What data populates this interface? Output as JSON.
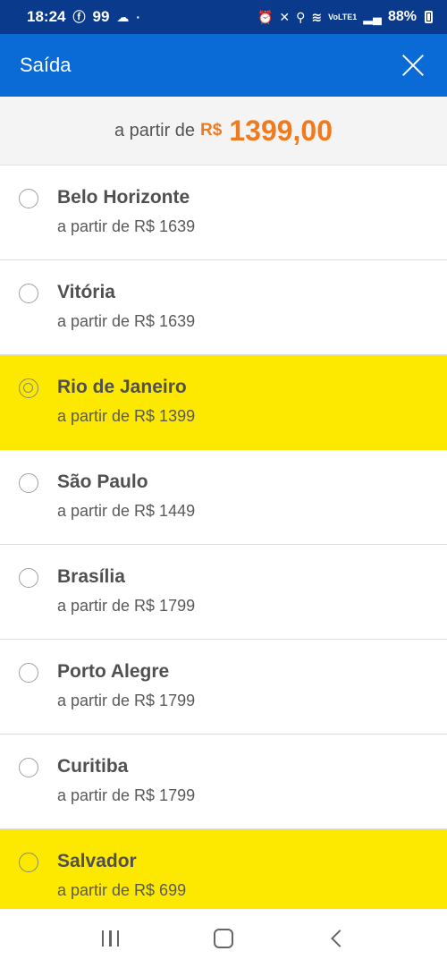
{
  "status_bar": {
    "time": "18:24",
    "notification_count": "99",
    "battery_percent": "88%",
    "network_label": "VoLTE1"
  },
  "header": {
    "title": "Saída"
  },
  "summary": {
    "prefix": "a partir de",
    "currency": "R$",
    "value": "1399,00"
  },
  "cities": [
    {
      "name": "Belo Horizonte",
      "price": "a partir de R$ 1639",
      "highlighted": false,
      "checked": false
    },
    {
      "name": "Vitória",
      "price": "a partir de R$ 1639",
      "highlighted": false,
      "checked": false
    },
    {
      "name": "Rio de Janeiro",
      "price": "a partir de R$ 1399",
      "highlighted": true,
      "checked": true
    },
    {
      "name": "São Paulo",
      "price": "a partir de R$ 1449",
      "highlighted": false,
      "checked": false
    },
    {
      "name": "Brasília",
      "price": "a partir de R$ 1799",
      "highlighted": false,
      "checked": false
    },
    {
      "name": "Porto Alegre",
      "price": "a partir de R$ 1799",
      "highlighted": false,
      "checked": false
    },
    {
      "name": "Curitiba",
      "price": "a partir de R$ 1799",
      "highlighted": false,
      "checked": false
    },
    {
      "name": "Salvador",
      "price": "a partir de R$ 699",
      "highlighted": true,
      "checked": false
    }
  ],
  "colors": {
    "header": "#0a6bd6",
    "status_bar": "#0a3a8c",
    "highlight": "#fde800",
    "price_accent": "#f07b1e"
  },
  "icons": {
    "close": "close-icon",
    "recents": "recents-icon",
    "home": "home-icon",
    "back": "back-icon"
  }
}
